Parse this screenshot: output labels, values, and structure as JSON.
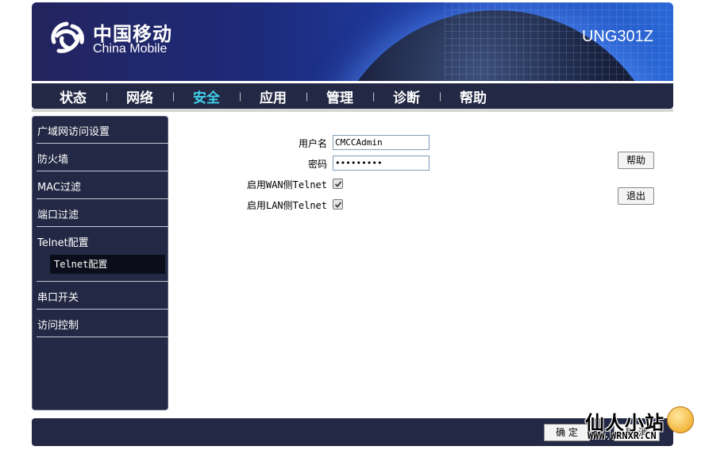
{
  "header": {
    "brand_cn": "中国移动",
    "brand_en": "China Mobile",
    "model": "UNG301Z"
  },
  "nav": {
    "items": [
      {
        "label": "状态",
        "active": false
      },
      {
        "label": "网络",
        "active": false
      },
      {
        "label": "安全",
        "active": true
      },
      {
        "label": "应用",
        "active": false
      },
      {
        "label": "管理",
        "active": false
      },
      {
        "label": "诊断",
        "active": false
      },
      {
        "label": "帮助",
        "active": false
      }
    ],
    "separator": "|",
    "active_color": "#3fd3ec"
  },
  "sidebar": {
    "items": [
      {
        "label": "广域网访问设置"
      },
      {
        "label": "防火墙"
      },
      {
        "label": "MAC过滤"
      },
      {
        "label": "端口过滤"
      },
      {
        "label": "Telnet配置"
      },
      {
        "label": "串口开关"
      },
      {
        "label": "访问控制"
      }
    ],
    "selected_sub": "Telnet配置"
  },
  "form": {
    "username_label": "用户名",
    "username_value": "CMCCAdmin",
    "password_label": "密码",
    "password_value": "•••••••••",
    "wan_telnet_label": "启用WAN侧Telnet",
    "wan_telnet_checked": true,
    "lan_telnet_label": "启用LAN侧Telnet",
    "lan_telnet_checked": true
  },
  "buttons": {
    "help": "帮助",
    "logout": "退出",
    "confirm": "确 定",
    "cancel": "取 消"
  },
  "watermark": {
    "text": "仙人小站",
    "url": "WWW.WRNXR.CN"
  },
  "colors": {
    "nav_bg": "#232844",
    "active_nav": "#3fd3ec"
  }
}
